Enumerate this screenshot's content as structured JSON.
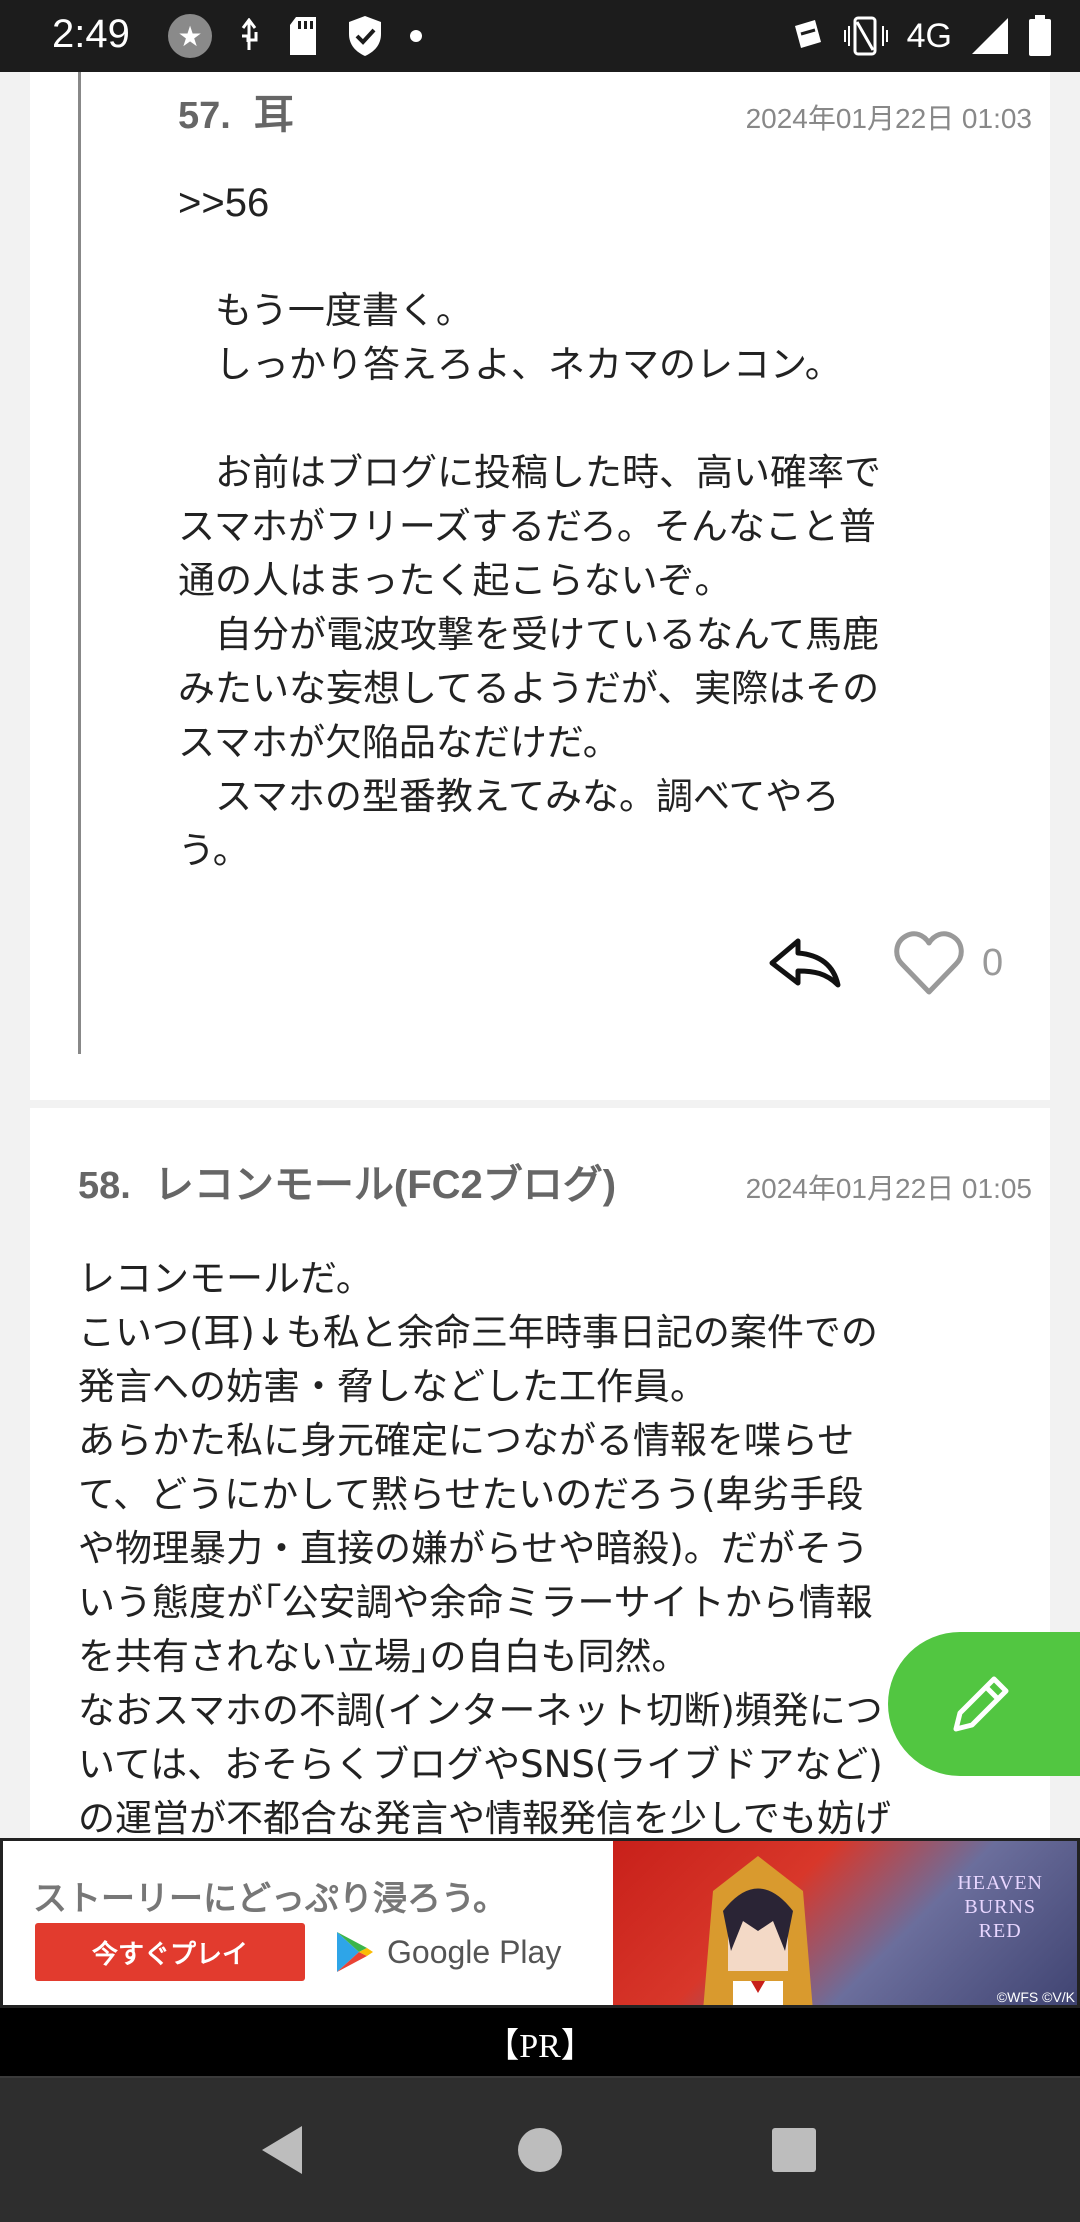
{
  "status_bar": {
    "time": "2:49",
    "network": "4G",
    "icons_left": [
      "notification-circle-icon",
      "usb-icon",
      "sd-card-icon",
      "shield-icon",
      "dot-icon"
    ],
    "icons_right": [
      "no-sim-icon",
      "vibrate-icon",
      "signal-icon",
      "battery-icon"
    ]
  },
  "posts": [
    {
      "number": "57.",
      "author": "耳",
      "date": "2024年01月22日 01:03",
      "anchor": ">>56",
      "body": "　もう一度書く。\n　しっかり答えろよ、ネカマのレコン。\n\n　お前はブログに投稿した時、高い確率で\nスマホがフリーズするだろ。そんなこと普\n通の人はまったく起こらないぞ。\n　自分が電波攻撃を受けているなんて馬鹿\nみたいな妄想してるようだが、実際はその\nスマホが欠陥品なだけだ。\n　スマホの型番教えてみな。調べてやろ\nう。",
      "like_count": "0"
    },
    {
      "number": "58.",
      "author": "レコンモール(FC2ブログ)",
      "date": "2024年01月22日 01:05",
      "body": "レコンモールだ。\nこいつ(耳)↓も私と余命三年時事日記の案件での\n発言への妨害・脅しなどした工作員。\nあらかた私に身元確定につながる情報を喋らせ\nて、どうにかして黙らせたいのだろう(卑劣手段\nや物理暴力・直接の嫌がらせや暗殺)。だがそう\nいう態度が｢公安調や余命ミラーサイトから情報\nを共有されない立場｣の自白も同然。\nなおスマホの不調(インターネット切断)頻発につ\nいては、おそらくブログやSNS(ライブドアなど)\nの運営が不都合な発言や情報発信を少しでも妨げ"
    }
  ],
  "ad": {
    "tagline": "ストーリーにどっぷり浸ろう。",
    "cta": "今すぐプレイ",
    "store": "Google Play",
    "game_logo": "HEAVEN\nBURNS\nRED",
    "copyright": "©WFS ©V/K",
    "pr_label": "【PR】"
  },
  "colors": {
    "fab": "#52c641",
    "ad_cta": "#e23b2e",
    "status_bar": "#1c1c1c",
    "nav_bar": "#2e2e2e"
  }
}
